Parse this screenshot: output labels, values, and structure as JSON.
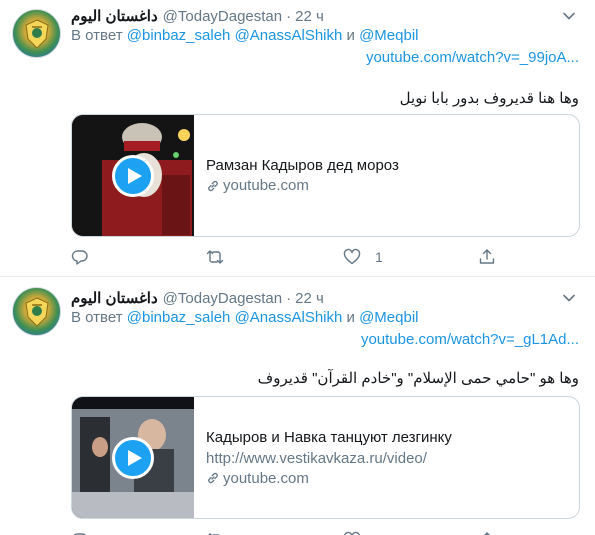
{
  "tweets": [
    {
      "author_name": "داغستان اليوم",
      "handle": "@TodayDagestan",
      "dot": "·",
      "time": "22 ч",
      "reply_prefix": "В ответ",
      "reply_user1": "@binbaz_saleh",
      "reply_user2": "@AnassAlShikh",
      "reply_and": "и",
      "reply_user3": "@Meqbil",
      "link": "youtube.com/watch?v=_99joA...",
      "text": "وها هنا قديروف بدور بابا نويل",
      "card_title": "Рамзан Кадыров дед мороз",
      "card_desc": "",
      "card_domain": "youtube.com",
      "like_count": "1"
    },
    {
      "author_name": "داغستان اليوم",
      "handle": "@TodayDagestan",
      "dot": "·",
      "time": "22 ч",
      "reply_prefix": "В ответ",
      "reply_user1": "@binbaz_saleh",
      "reply_user2": "@AnassAlShikh",
      "reply_and": "и",
      "reply_user3": "@Meqbil",
      "link": "youtube.com/watch?v=_gL1Ad...",
      "text": "وها هو \"حامي حمى الإسلام\" و\"خادم القرآن\" قديروف",
      "card_title": "Кадыров и Навка танцуют лезгинку",
      "card_desc": "http://www.vestikavkaza.ru/video/",
      "card_domain": "youtube.com",
      "like_count": ""
    }
  ],
  "colors": {
    "link": "#1b95e0",
    "accent": "#1da1f2",
    "muted": "#657786",
    "border": "#ccd6dd"
  },
  "icons": [
    "avatar-emblem",
    "chevron-down-icon",
    "play-icon",
    "link-icon",
    "reply-icon",
    "retweet-icon",
    "like-icon",
    "share-icon"
  ]
}
